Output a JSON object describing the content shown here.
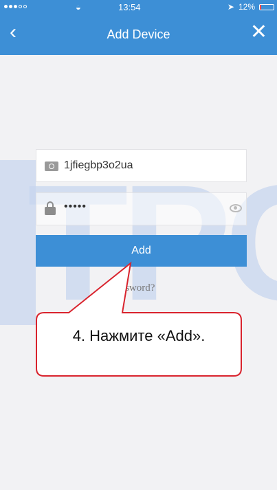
{
  "status_bar": {
    "time": "13:54",
    "battery_percent": "12%",
    "battery_level": 0.12,
    "wifi_icon": "wifi-icon",
    "signal_icon": "signal-dots-icon"
  },
  "nav": {
    "title": "Add Device",
    "back_icon": "chevron-left-icon",
    "close_icon": "close-icon"
  },
  "watermark": {
    "text": "TPC"
  },
  "form": {
    "device_id": "1jfiegbp3o2ua",
    "password_mask": "•••••",
    "add_label": "Add",
    "forgot_label": "F    password?"
  },
  "callout": {
    "text": "4. Нажмите «Add»."
  },
  "colors": {
    "accent": "#3d8fd6",
    "callout_border": "#d9232d",
    "watermark": "#c8d6ef"
  }
}
